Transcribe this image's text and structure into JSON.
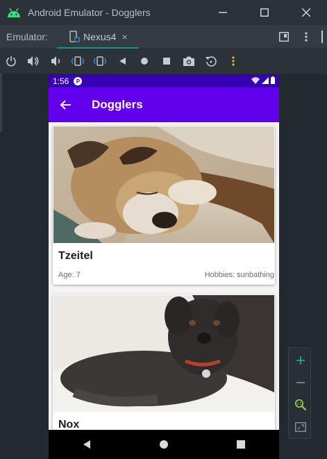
{
  "window": {
    "title": "Android Emulator - Dogglers",
    "minimize_icon": "minimize-icon",
    "maximize_icon": "maximize-icon",
    "close_icon": "close-icon"
  },
  "tabbar": {
    "label": "Emulator:",
    "tab_label": "Nexus4",
    "tab_close": "×"
  },
  "toolbar": {
    "tools": [
      "power-icon",
      "volume-up-icon",
      "volume-down-icon",
      "rotate-left-icon",
      "rotate-right-icon",
      "back-icon",
      "home-icon",
      "overview-icon",
      "camera-icon",
      "replay-icon",
      "more-icon"
    ]
  },
  "phone": {
    "status": {
      "time": "1:56",
      "notif": "P"
    },
    "appbar": {
      "title": "Dogglers"
    },
    "dogs": [
      {
        "name": "Tzeitel",
        "age": "Age: 7",
        "hobbies": "Hobbies: sunbathing"
      },
      {
        "name": "Nox",
        "age": "",
        "hobbies": ""
      }
    ]
  },
  "colors": {
    "primary": "#6200ee",
    "primary_dark": "#3700b3",
    "accent_teal": "#1e8f89",
    "zoom_accent": "#19b5a8",
    "zoom_green": "#9fd63b"
  }
}
